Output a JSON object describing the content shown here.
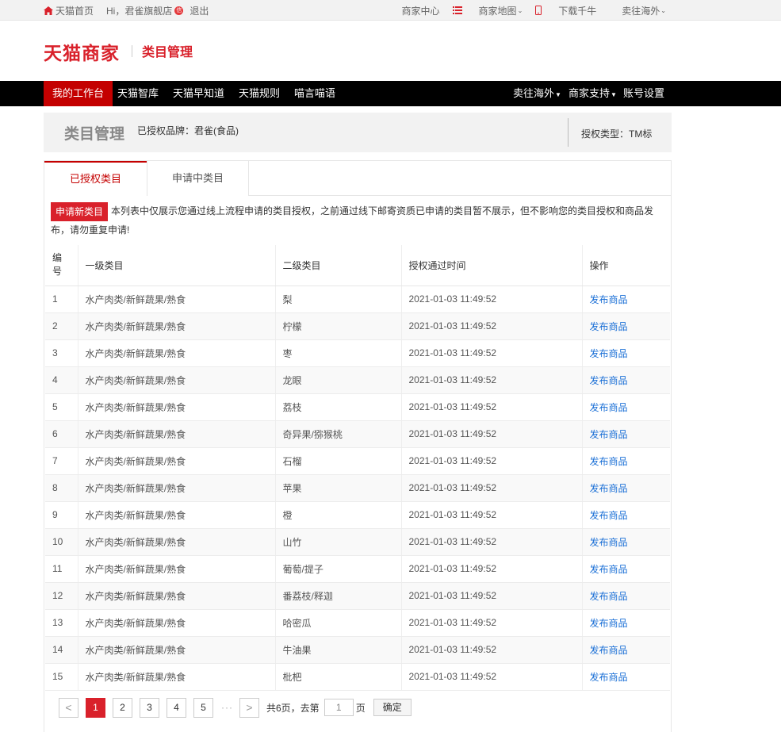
{
  "topbar": {
    "home": "天猫首页",
    "greeting": "Hi，君雀旗舰店",
    "mail_badge": "信",
    "logout": "退出",
    "links": [
      "商家中心",
      "商家地图",
      "下载千牛",
      "卖往海外"
    ]
  },
  "header": {
    "logo": "天猫商家",
    "title": "类目管理"
  },
  "nav": {
    "left": [
      "我的工作台",
      "天猫智库",
      "天猫早知道",
      "天猫规则",
      "喵言喵语"
    ],
    "right": [
      "卖往海外",
      "商家支持",
      "账号设置"
    ]
  },
  "titlebar": {
    "title": "类目管理",
    "brand": "已授权品牌：君雀(食品)",
    "auth_type": "授权类型：TM标"
  },
  "tabs": [
    "已授权类目",
    "申请中类目"
  ],
  "notice": {
    "button": "申请新类目",
    "text": "本列表中仅展示您通过线上流程申请的类目授权，之前通过线下邮寄资质已申请的类目暂不展示，但不影响您的类目授权和商品发布，请勿重复申请!"
  },
  "table": {
    "headers": [
      "编号",
      "一级类目",
      "二级类目",
      "授权通过时间",
      "操作"
    ],
    "rows": [
      [
        "1",
        "水产肉类/新鲜蔬果/熟食",
        "梨",
        "2021-01-03 11:49:52",
        "发布商品"
      ],
      [
        "2",
        "水产肉类/新鲜蔬果/熟食",
        "柠檬",
        "2021-01-03 11:49:52",
        "发布商品"
      ],
      [
        "3",
        "水产肉类/新鲜蔬果/熟食",
        "枣",
        "2021-01-03 11:49:52",
        "发布商品"
      ],
      [
        "4",
        "水产肉类/新鲜蔬果/熟食",
        "龙眼",
        "2021-01-03 11:49:52",
        "发布商品"
      ],
      [
        "5",
        "水产肉类/新鲜蔬果/熟食",
        "荔枝",
        "2021-01-03 11:49:52",
        "发布商品"
      ],
      [
        "6",
        "水产肉类/新鲜蔬果/熟食",
        "奇异果/猕猴桃",
        "2021-01-03 11:49:52",
        "发布商品"
      ],
      [
        "7",
        "水产肉类/新鲜蔬果/熟食",
        "石榴",
        "2021-01-03 11:49:52",
        "发布商品"
      ],
      [
        "8",
        "水产肉类/新鲜蔬果/熟食",
        "苹果",
        "2021-01-03 11:49:52",
        "发布商品"
      ],
      [
        "9",
        "水产肉类/新鲜蔬果/熟食",
        "橙",
        "2021-01-03 11:49:52",
        "发布商品"
      ],
      [
        "10",
        "水产肉类/新鲜蔬果/熟食",
        "山竹",
        "2021-01-03 11:49:52",
        "发布商品"
      ],
      [
        "11",
        "水产肉类/新鲜蔬果/熟食",
        "葡萄/提子",
        "2021-01-03 11:49:52",
        "发布商品"
      ],
      [
        "12",
        "水产肉类/新鲜蔬果/熟食",
        "番荔枝/释迦",
        "2021-01-03 11:49:52",
        "发布商品"
      ],
      [
        "13",
        "水产肉类/新鲜蔬果/熟食",
        "哈密瓜",
        "2021-01-03 11:49:52",
        "发布商品"
      ],
      [
        "14",
        "水产肉类/新鲜蔬果/熟食",
        "牛油果",
        "2021-01-03 11:49:52",
        "发布商品"
      ],
      [
        "15",
        "水产肉类/新鲜蔬果/熟食",
        "枇杷",
        "2021-01-03 11:49:52",
        "发布商品"
      ]
    ]
  },
  "pager": {
    "prev": "<",
    "pages": [
      "1",
      "2",
      "3",
      "4",
      "5"
    ],
    "current": "1",
    "ellipsis": "···",
    "next": ">",
    "total": "共6页，去第",
    "input_value": "1",
    "page_unit": "页",
    "confirm": "确定"
  },
  "colors": {
    "brand_red": "#d9212b",
    "nav_active": "#c40000",
    "link_blue": "#1a6fd6"
  }
}
